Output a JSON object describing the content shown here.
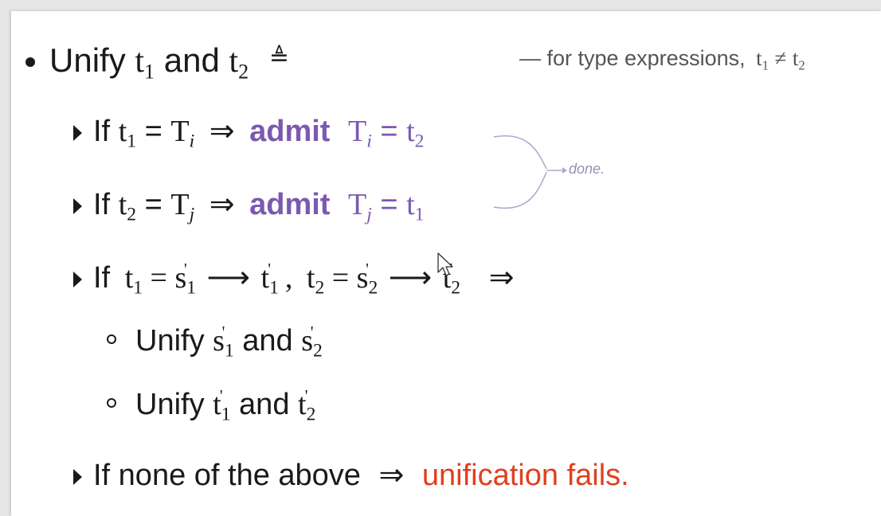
{
  "heading": {
    "text": "Unify",
    "t": "t",
    "sub1": "1",
    "and": "and",
    "sub2": "2",
    "defeq": "≜",
    "note": "— for type expressions,",
    "note_t1": "t",
    "note_sub1": "1",
    "neq": "≠",
    "note_t2": "t",
    "note_sub2": "2"
  },
  "rule1": {
    "if": "If",
    "t": "t",
    "sub": "1",
    "eq": "=",
    "T": "T",
    "idx": "i",
    "implies": "⇒",
    "admit": "admit",
    "eq2": "=",
    "rhs": "t",
    "rhs_sub": "2"
  },
  "rule2": {
    "if": "If",
    "t": "t",
    "sub": "2",
    "eq": "=",
    "T": "T",
    "idx": "j",
    "implies": "⇒",
    "admit": "admit",
    "eq2": "=",
    "rhs": "t",
    "rhs_sub": "1"
  },
  "done_note": "done.",
  "rule3": {
    "if": "If",
    "lhs1": "t",
    "lhs1_sub": "1",
    "eq": "=",
    "s": "s",
    "s1_sub": "1",
    "arrow": "⟶",
    "t": "t",
    "t1_sub": "1",
    "comma": ",",
    "lhs2": "t",
    "lhs2_sub": "2",
    "s2_sub": "2",
    "t2_sub": "2",
    "implies": "⇒",
    "prime": "'"
  },
  "sub_a": {
    "unify": "Unify",
    "s": "s",
    "sub1": "1",
    "and": "and",
    "sub2": "2"
  },
  "sub_b": {
    "unify": "Unify",
    "t": "t",
    "sub1": "1",
    "and": "and",
    "sub2": "2"
  },
  "rule4": {
    "if": "If none of the above",
    "implies": "⇒",
    "result": "unification fails."
  },
  "colors": {
    "keyword": "#7b59b0",
    "failure": "#e0401f",
    "note": "#9a8fb5"
  }
}
